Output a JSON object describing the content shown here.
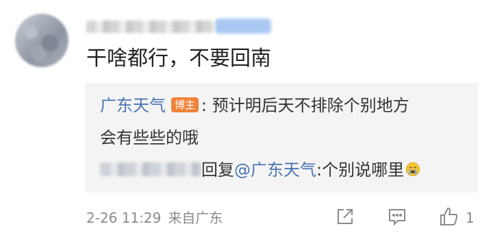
{
  "comment": {
    "text": "干啥都行，不要回南"
  },
  "quote": {
    "author": "广东天气",
    "author_badge": "博主",
    "text_part1": ": 预计明后天不排除个别地方",
    "text_part2": "会有些些的哦",
    "reply_label": "回复",
    "reply_mention": "@广东天气",
    "reply_text": ":个别说哪里"
  },
  "footer": {
    "time": "2-26 11:29",
    "source": "来自广东",
    "like_count": "1"
  },
  "icons": {
    "share": "share-icon",
    "comment": "comment-icon",
    "like": "thumbs-up-icon",
    "emoji": "crying-emoji-icon"
  },
  "colors": {
    "link": "#4a74b5",
    "badge": "#f0823a",
    "quote_bg": "#f4f4f4",
    "meta": "#8a8a8a"
  }
}
